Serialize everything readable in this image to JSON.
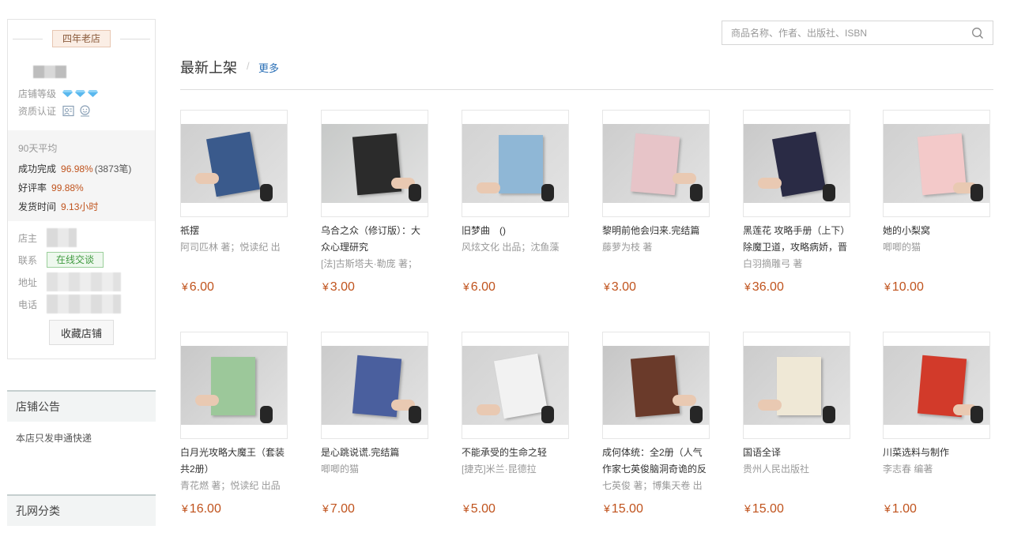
{
  "shop": {
    "age_badge": "四年老店",
    "level_label": "店铺等级",
    "qualification_label": "资质认证",
    "stats_heading": "90天平均",
    "completion_label": "成功完成",
    "completion_value": "96.98%",
    "completion_count": "(3873笔)",
    "rating_label": "好评率",
    "rating_value": "99.88%",
    "ship_label": "发货时间",
    "ship_value": "9.13小时",
    "owner_label": "店主",
    "contact_label": "联系",
    "chat_button": "在线交谈",
    "address_label": "地址",
    "phone_label": "电话",
    "collect_button": "收藏店铺"
  },
  "notice": {
    "title": "店铺公告",
    "text": "本店只发申通快递"
  },
  "categories": {
    "title": "孔网分类"
  },
  "search": {
    "placeholder": "商品名称、作者、出版社、ISBN"
  },
  "section": {
    "title": "最新上架",
    "separator": "/",
    "more": "更多"
  },
  "currency": "¥",
  "products": [
    {
      "title": "祇摆",
      "sub1": "阿司匹林 著；悦读纪 出",
      "sub2": "",
      "price": "6.00"
    },
    {
      "title": "乌合之众（修订版）：大众心理研究",
      "sub1": "[法]古斯塔夫·勒庞 著；",
      "sub2": "",
      "price": "3.00"
    },
    {
      "title": "旧梦曲　()",
      "sub1": "风炫文化 出品；沈鱼藻",
      "sub2": "",
      "price": "6.00"
    },
    {
      "title": "黎明前他会归来.完结篇",
      "sub1": "藤萝为枝 著",
      "sub2": "",
      "price": "3.00"
    },
    {
      "title": "黑莲花 攻略手册（上下）除魔卫道，攻略病娇，晋",
      "sub1": "白羽摘雕弓 著",
      "sub2": "",
      "price": "36.00"
    },
    {
      "title": "她的小梨窝",
      "sub1": "唧唧的猫",
      "sub2": "",
      "price": "10.00"
    },
    {
      "title": "白月光攻略大魔王（套装共2册）",
      "sub1": "青花燃 著；悦读纪 出品",
      "sub2": "",
      "price": "16.00"
    },
    {
      "title": "是心跳说谎.完结篇",
      "sub1": "唧唧的猫",
      "sub2": "",
      "price": "7.00"
    },
    {
      "title": "不能承受的生命之轻",
      "sub1": "[捷克]米兰·昆德拉",
      "sub2": "",
      "price": "5.00"
    },
    {
      "title": "成何体统：全2册（人气作家七英俊脑洞奇诡的反",
      "sub1": "七英俊 著；博集天卷 出",
      "sub2": "",
      "price": "15.00"
    },
    {
      "title": "国语全译",
      "sub1": "贵州人民出版社",
      "sub2": "",
      "price": "15.00"
    },
    {
      "title": "川菜选料与制作",
      "sub1": "李志春 编著",
      "sub2": "",
      "price": "1.00"
    }
  ],
  "colors": {
    "price": "#c0531d",
    "link": "#2a6fb6",
    "chat_green": "#3f9a3f",
    "diamond": "#5ab8ee"
  },
  "icons": [
    "diamond-icon",
    "license-icon",
    "face-verify-icon",
    "search-icon"
  ]
}
